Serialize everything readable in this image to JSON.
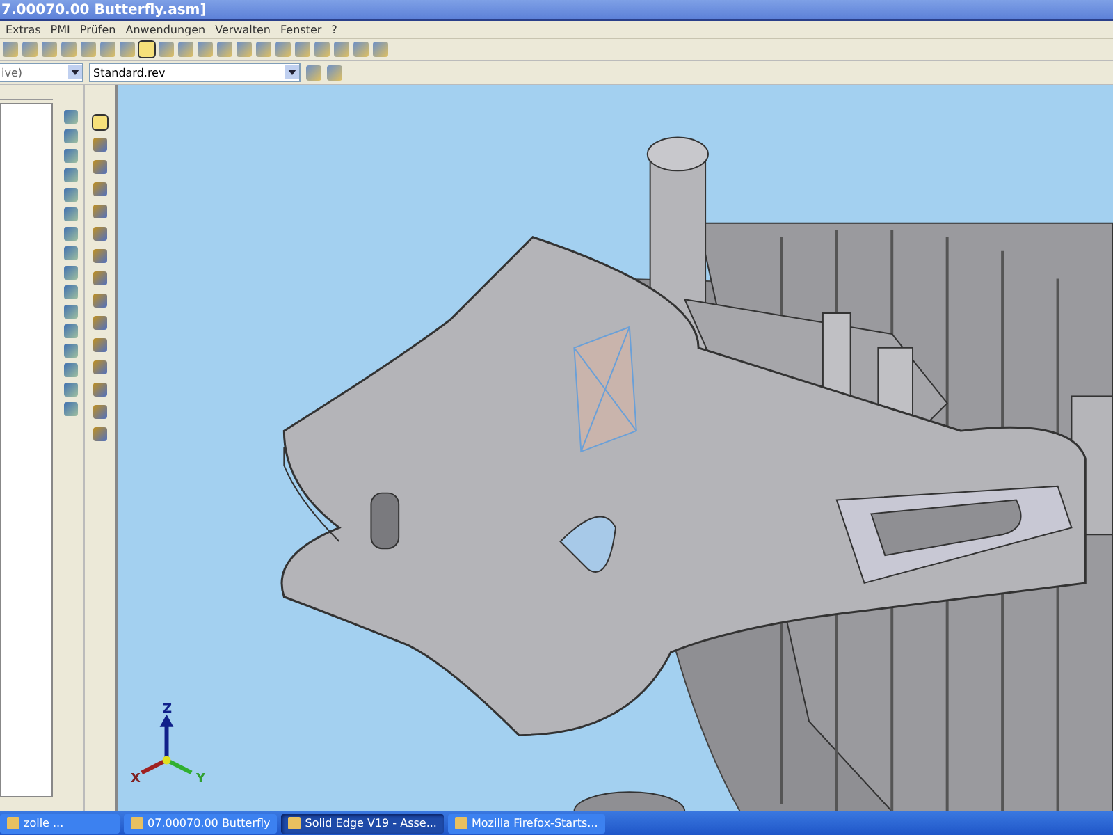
{
  "window": {
    "title": "7.00070.00 Butterfly.asm]"
  },
  "menu": [
    "Extras",
    "PMI",
    "Prüfen",
    "Anwendungen",
    "Verwalten",
    "Fenster",
    "?"
  ],
  "toolbar": {
    "combo_left": "ive)",
    "combo_style": "Standard.rev"
  },
  "viewport": {
    "axes": {
      "z": "Z",
      "x": "X",
      "y": "Y"
    }
  },
  "taskbar": [
    {
      "label": "zolle ...",
      "selected": false
    },
    {
      "label": "07.00070.00 Butterfly",
      "selected": false
    },
    {
      "label": "Solid Edge V19 - Asse...",
      "selected": true
    },
    {
      "label": "Mozilla Firefox-Starts...",
      "selected": false
    }
  ]
}
